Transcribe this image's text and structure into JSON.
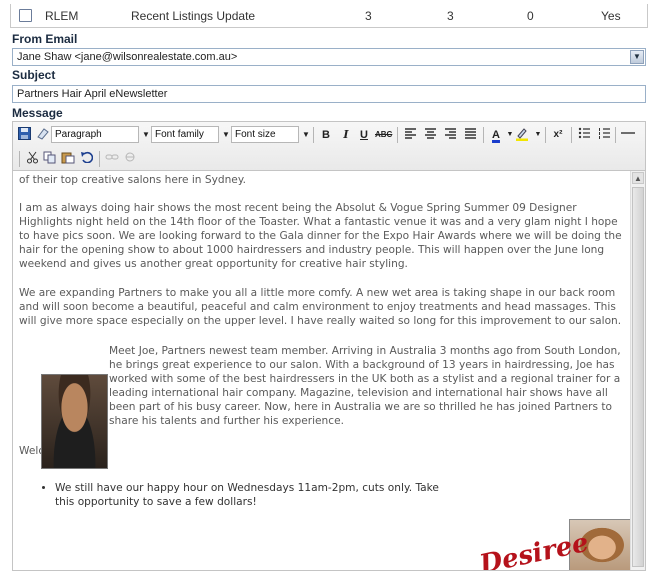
{
  "list_row": {
    "code": "RLEM",
    "name": "Recent Listings Update",
    "col3": "3",
    "col4": "3",
    "col5": "0",
    "col6": "Yes"
  },
  "from_email": {
    "label": "From Email",
    "value": "Jane Shaw <jane@wilsonrealestate.com.au>"
  },
  "subject": {
    "label": "Subject",
    "value": "Partners Hair April eNewsletter"
  },
  "message": {
    "label": "Message"
  },
  "toolbar": {
    "format": "Paragraph",
    "font_family": "Font family",
    "font_size": "Font size",
    "bold": "B",
    "italic": "I",
    "underline": "U",
    "strike": "ABC",
    "superscript": "x²"
  },
  "editor": {
    "line0": "of their top creative salons here in Sydney.",
    "para1": "I am as always doing hair shows the most recent being the Absolut & Vogue Spring Summer 09 Designer Highlights night held on the 14th floor of the Toaster. What a fantastic venue it was and a very glam night I hope to have pics soon. We are looking forward to the Gala dinner for the Expo Hair Awards where we will be doing the hair for the opening show to about 1000 hairdressers and industry people. This will happen over the June long weekend and gives us another great opportunity for creative hair styling.",
    "para2": "We are expanding Partners to make you all a little more comfy. A new wet area is taking shape in our back room and will soon become a beautiful, peaceful and calm environment to enjoy treatments and head massages. This will give more space especially on the upper level. I have really waited so long for this improvement to our salon.",
    "para3": "Meet Joe, Partners newest team member. Arriving in Australia 3 months ago from South London, he brings great experience to our salon. With a background of 13 years in hairdressing, Joe has worked with some of the best hairdressers in the UK both as a stylist and a regional trainer for a leading international hair company. Magazine, television and international hair shows have all been part of his busy career. Now, here in Australia we are so thrilled he has joined Partners to share his talents and further his experience.",
    "welcome": "Welcome Joe!",
    "bullet1": "We still have our happy hour on Wednesdays 11am-2pm, cuts only. Take this opportunity to save a few dollars!",
    "logo_text": "Desiree"
  },
  "colors": {
    "label_text": "#1b2b40",
    "field_border": "#9ab0c8",
    "body_text": "#5a5a5a",
    "logo_red": "#b5121b"
  },
  "icons": [
    "save-icon",
    "eraser-icon",
    "align-left-icon",
    "align-center-icon",
    "align-right-icon",
    "align-justify-icon",
    "text-color-icon",
    "highlight-color-icon",
    "bullet-list-icon",
    "numbered-list-icon",
    "horizontal-rule-icon",
    "cut-icon",
    "copy-icon",
    "paste-icon",
    "undo-icon",
    "link-icon",
    "unlink-icon"
  ]
}
